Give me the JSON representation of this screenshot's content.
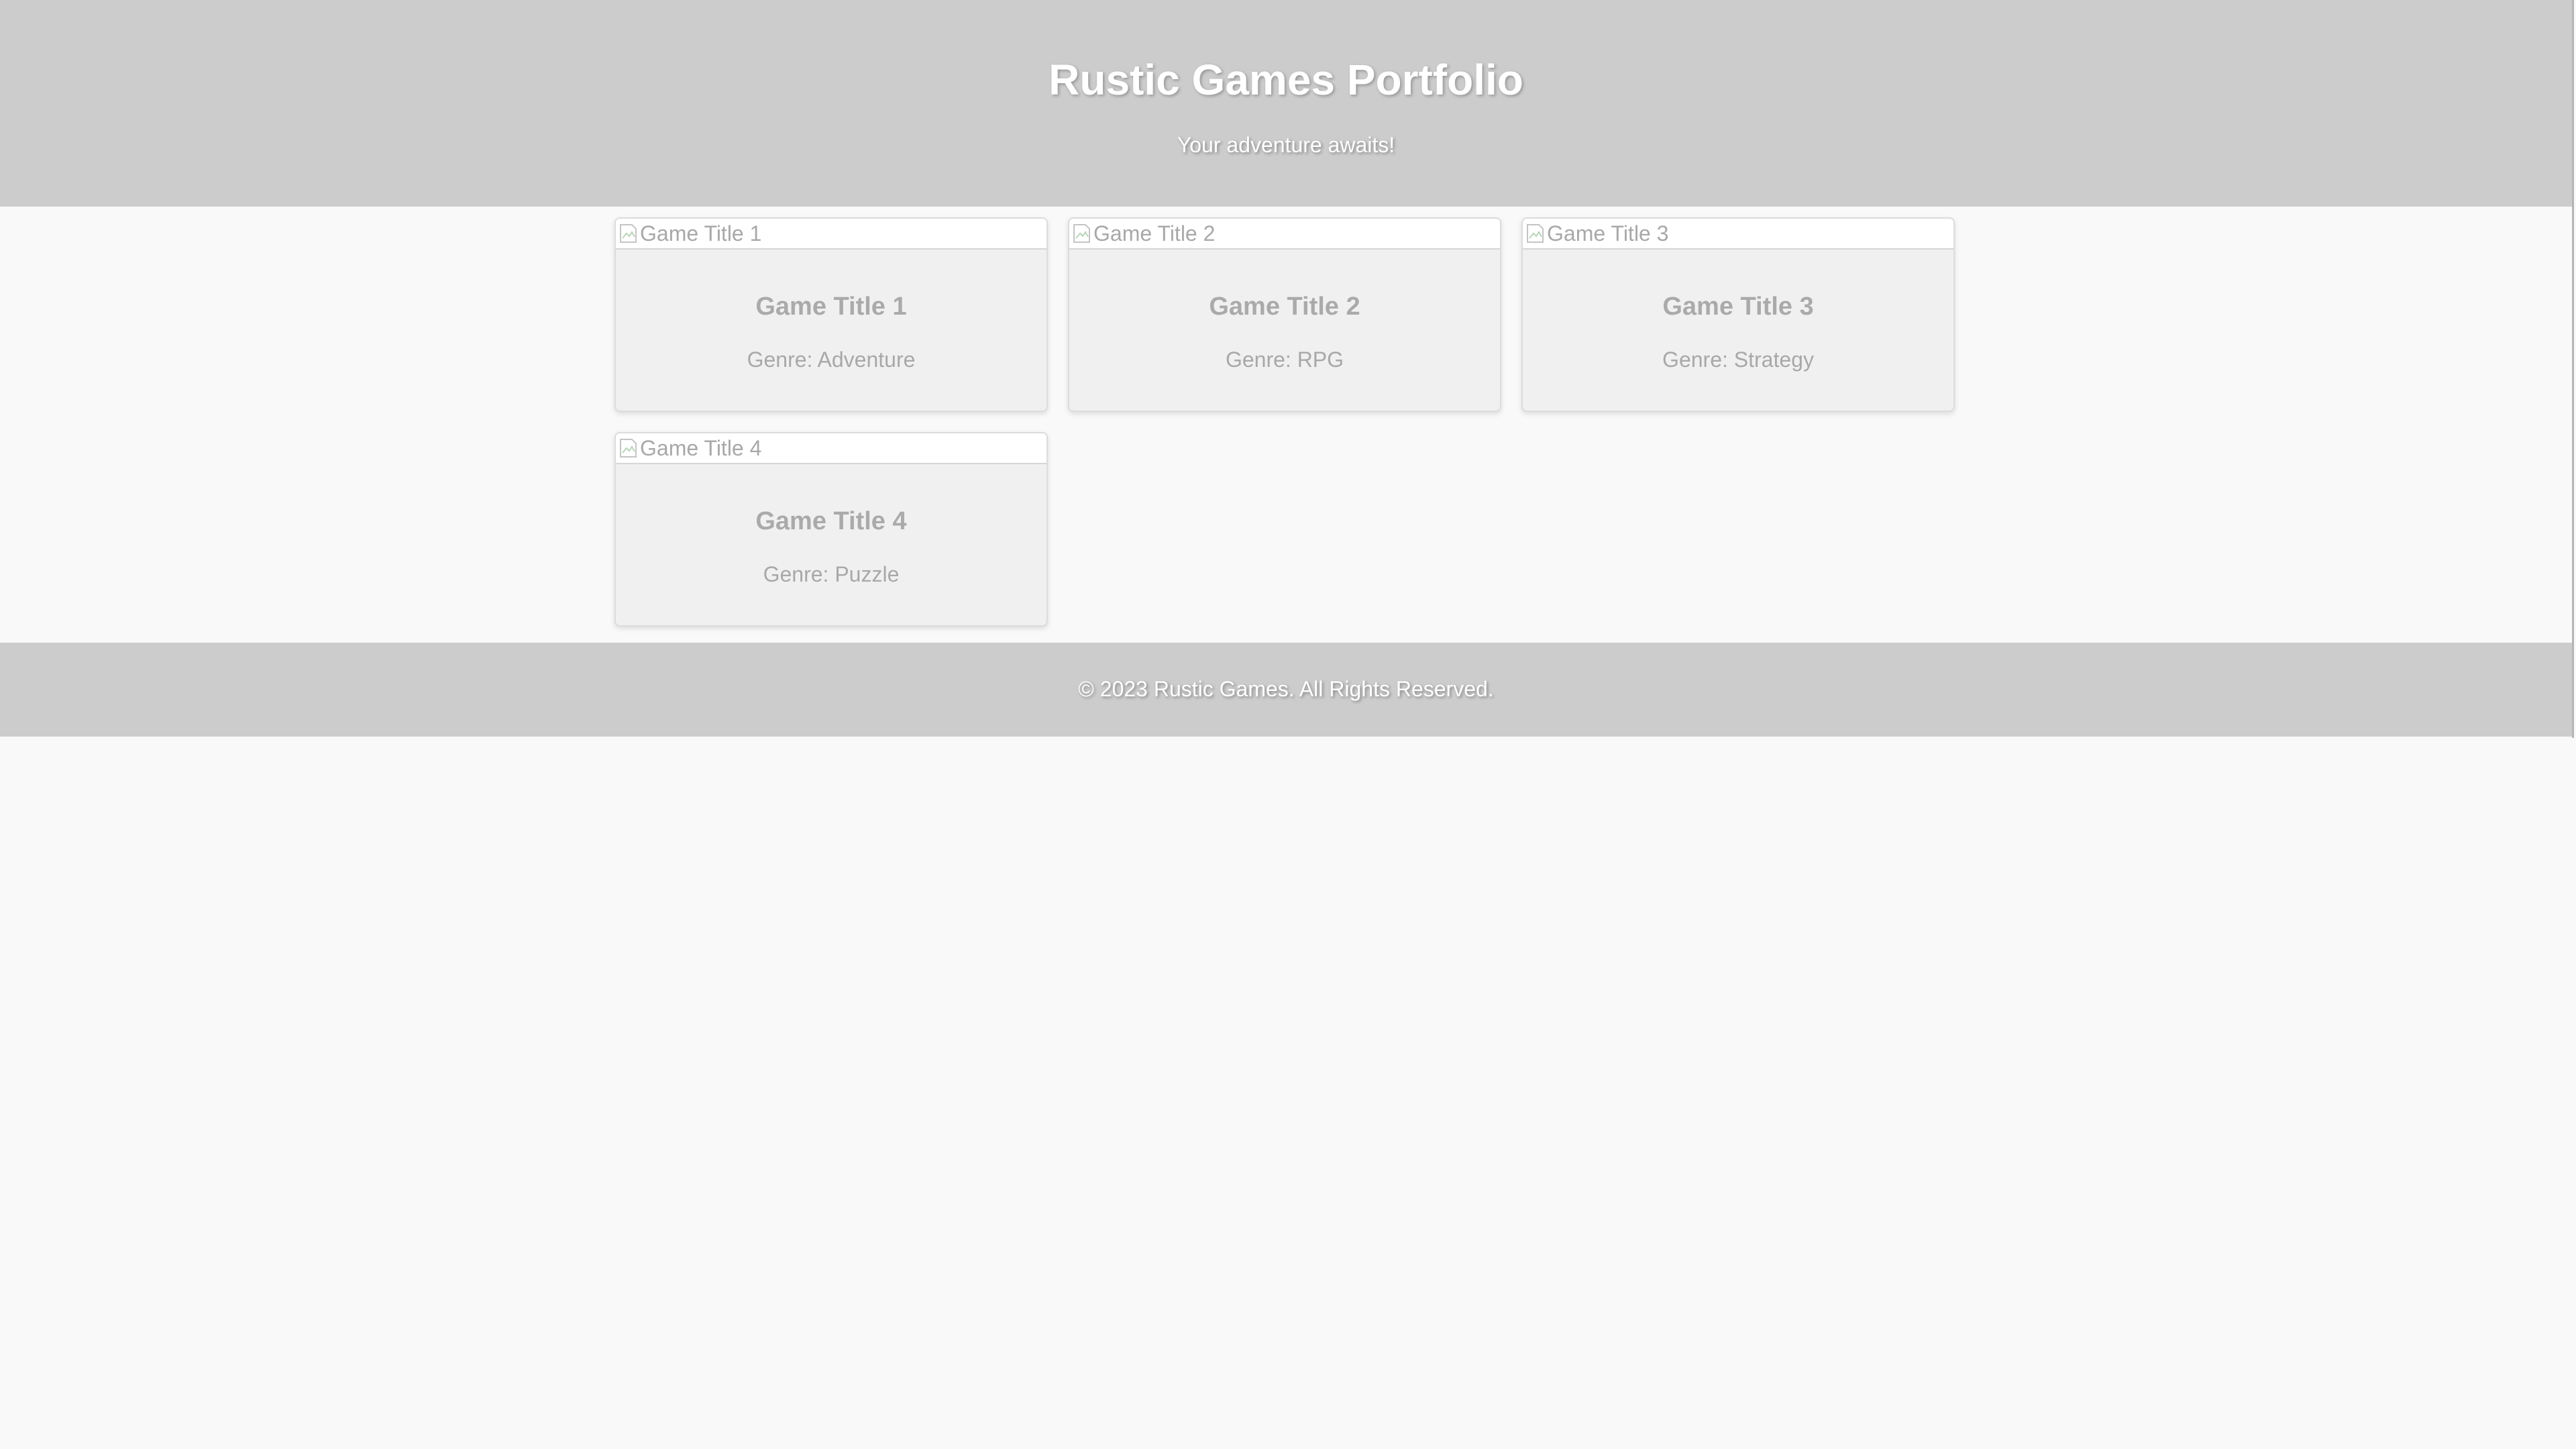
{
  "header": {
    "title": "Rustic Games Portfolio",
    "tagline": "Your adventure awaits!"
  },
  "games": [
    {
      "image_alt": "Game Title 1",
      "title": "Game Title 1",
      "genre": "Genre: Adventure"
    },
    {
      "image_alt": "Game Title 2",
      "title": "Game Title 2",
      "genre": "Genre: RPG"
    },
    {
      "image_alt": "Game Title 3",
      "title": "Game Title 3",
      "genre": "Genre: Strategy"
    },
    {
      "image_alt": "Game Title 4",
      "title": "Game Title 4",
      "genre": "Genre: Puzzle"
    }
  ],
  "footer": {
    "text": "© 2023 Rustic Games. All Rights Reserved."
  },
  "colors": {
    "header_bg": "#cccccc",
    "page_bg": "#f9f9f9",
    "card_bg": "#f0f0f0",
    "text_muted": "#aaaaaa"
  },
  "icons": {
    "thumbnail": "broken-image-icon"
  }
}
